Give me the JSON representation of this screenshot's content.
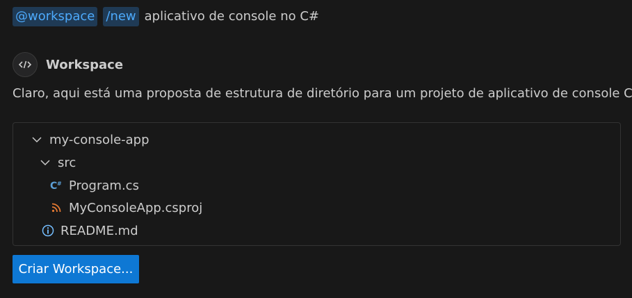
{
  "query": {
    "agent_chip": "@workspace",
    "command_chip": "/new",
    "text": "aplicativo de console no C#"
  },
  "response": {
    "agent_name": "Workspace",
    "description": "Claro, aqui está uma proposta de estrutura de diretório para um projeto de aplicativo de console C#:"
  },
  "tree": {
    "root_folder": "my-console-app",
    "src_folder": "src",
    "files": [
      {
        "name": "Program.cs",
        "icon": "csharp-icon"
      },
      {
        "name": "MyConsoleApp.csproj",
        "icon": "rss-icon"
      }
    ],
    "readme": {
      "name": "README.md",
      "icon": "info-icon"
    }
  },
  "action": {
    "create_label": "Criar Workspace..."
  },
  "colors": {
    "background": "#181818",
    "chip_bg": "#1f3a55",
    "chip_fg": "#4daafc",
    "button_bg": "#0e78d4",
    "csharp": "#5c9fd6",
    "rss": "#e37933",
    "info": "#75beff"
  }
}
